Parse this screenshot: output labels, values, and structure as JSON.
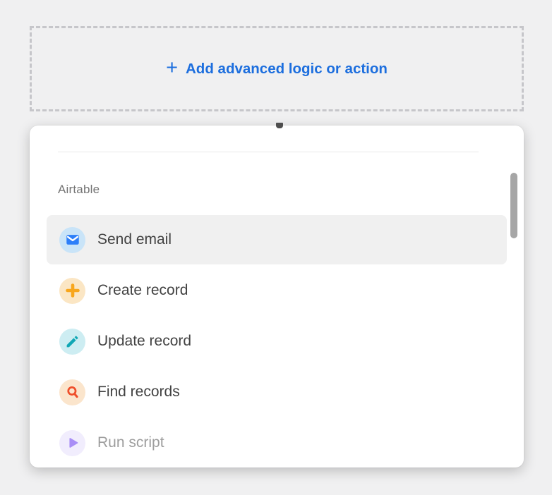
{
  "add_button": {
    "plus_glyph": "+",
    "label": "Add advanced logic or action"
  },
  "dropdown": {
    "section_label": "Airtable",
    "items": [
      {
        "label": "Send email",
        "icon": "envelope-icon",
        "icon_color": "#2d7ff9",
        "icon_bg": "#c9e4f8",
        "state": "hovered"
      },
      {
        "label": "Create record",
        "icon": "plus-icon",
        "icon_color": "#f8a61c",
        "icon_bg": "#fbe6c4",
        "state": "default"
      },
      {
        "label": "Update record",
        "icon": "pencil-icon",
        "icon_color": "#10a7b5",
        "icon_bg": "#cdedf2",
        "state": "default"
      },
      {
        "label": "Find records",
        "icon": "search-icon",
        "icon_color": "#ef4f2a",
        "icon_bg": "#fbe5cc",
        "state": "default"
      },
      {
        "label": "Run script",
        "icon": "play-icon",
        "icon_color": "#a98ef6",
        "icon_bg": "#f1edfd",
        "state": "disabled"
      }
    ]
  },
  "colors": {
    "accent_blue": "#1c6ede",
    "page_background": "#f0f0f1",
    "panel_background": "#ffffff",
    "hover_row_background": "#f0f0f0",
    "dashed_border": "#c6c6ca",
    "divider": "#e9e9e9",
    "section_label_text": "#747474",
    "item_text": "#424242",
    "disabled_item_text": "#9d9d9d",
    "scrollbar_thumb": "#a6a6a6"
  }
}
